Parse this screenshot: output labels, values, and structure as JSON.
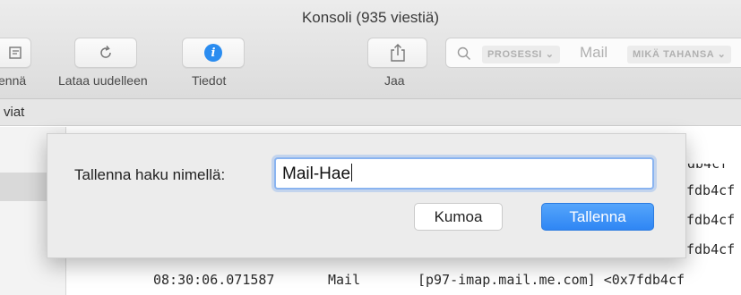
{
  "window": {
    "title": "Konsoli (935 viestiä)"
  },
  "toolbar": {
    "items": [
      {
        "label": "ennä",
        "icon": "clear-icon"
      },
      {
        "label": "Lataa uudelleen",
        "icon": "reload-icon"
      },
      {
        "label": "Tiedot",
        "icon": "info-icon"
      },
      {
        "label": "Jaa",
        "icon": "share-icon"
      }
    ],
    "search": {
      "token1": "PROSESSI ⌄",
      "value": "Mail",
      "token2": "MIKÄ TAHANSA ⌄"
    }
  },
  "filterbar": {
    "text": "viat"
  },
  "log": {
    "lines": [
      {
        "tail": "fdb4cf"
      },
      {
        "tail": "fdb4cf"
      },
      {
        "tail": "fdb4cf"
      },
      {
        "tail": "fdb4cf"
      }
    ],
    "last_row": {
      "time": "08:30:06.071587",
      "process": "Mail",
      "message": "[p97-imap.mail.me.com] <0x7fdb4cf"
    }
  },
  "dialog": {
    "label": "Tallenna haku nimellä:",
    "input_value": "Mail-Hae",
    "cancel": "Kumoa",
    "save": "Tallenna"
  },
  "colors": {
    "accent": "#2f86f4",
    "info": "#2a8cf0"
  }
}
